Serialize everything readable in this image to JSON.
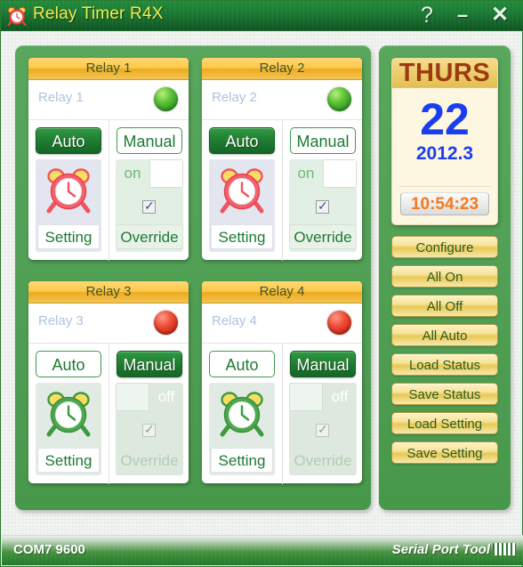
{
  "window": {
    "title": "Relay Timer R4X",
    "icon": "alarm-clock-icon",
    "help_label": "?",
    "minimize_label": "–",
    "close_label": "✕"
  },
  "colors": {
    "frame_green": "#4f9e53",
    "titlebar_green": "#1b7a33",
    "title_yellow": "#f5ec4d",
    "header_gold": "#fbc84b",
    "led_on": "#2f9b22",
    "led_off": "#ef5038",
    "active_button": "#1f7a30",
    "date_blue": "#1a3df0",
    "dow_brown": "#9a3b13",
    "time_orange": "#f47a1f",
    "action_button_gold": "#f7e49b"
  },
  "relays": [
    {
      "header": "Relay 1",
      "name": "Relay 1",
      "led": "on",
      "auto_label": "Auto",
      "manual_label": "Manual",
      "mode": "auto",
      "setting_label": "Setting",
      "toggle_state": "on",
      "toggle_label": "on",
      "override_label": "Override",
      "override_checked": true,
      "clock_icon": "alarm-clock-icon-red"
    },
    {
      "header": "Relay 2",
      "name": "Relay 2",
      "led": "on",
      "auto_label": "Auto",
      "manual_label": "Manual",
      "mode": "auto",
      "setting_label": "Setting",
      "toggle_state": "on",
      "toggle_label": "on",
      "override_label": "Override",
      "override_checked": true,
      "clock_icon": "alarm-clock-icon-red"
    },
    {
      "header": "Relay 3",
      "name": "Relay 3",
      "led": "off",
      "auto_label": "Auto",
      "manual_label": "Manual",
      "mode": "manual",
      "setting_label": "Setting",
      "toggle_state": "off",
      "toggle_label": "off",
      "override_label": "Override",
      "override_checked": true,
      "clock_icon": "alarm-clock-icon-green"
    },
    {
      "header": "Relay 4",
      "name": "Relay 4",
      "led": "off",
      "auto_label": "Auto",
      "manual_label": "Manual",
      "mode": "manual",
      "setting_label": "Setting",
      "toggle_state": "off",
      "toggle_label": "off",
      "override_label": "Override",
      "override_checked": true,
      "clock_icon": "alarm-clock-icon-green"
    }
  ],
  "datecard": {
    "day_of_week": "THURS",
    "day_number": "22",
    "year_month": "2012.3",
    "time": "10:54:23"
  },
  "actions": [
    {
      "label": "Configure"
    },
    {
      "label": "All On"
    },
    {
      "label": "All Off"
    },
    {
      "label": "All Auto"
    },
    {
      "label": "Load Status"
    },
    {
      "label": "Save Status"
    },
    {
      "label": "Load Setting"
    },
    {
      "label": "Save Setting"
    }
  ],
  "statusbar": {
    "port_info": "COM7 9600",
    "brand": "Serial Port Tool"
  }
}
